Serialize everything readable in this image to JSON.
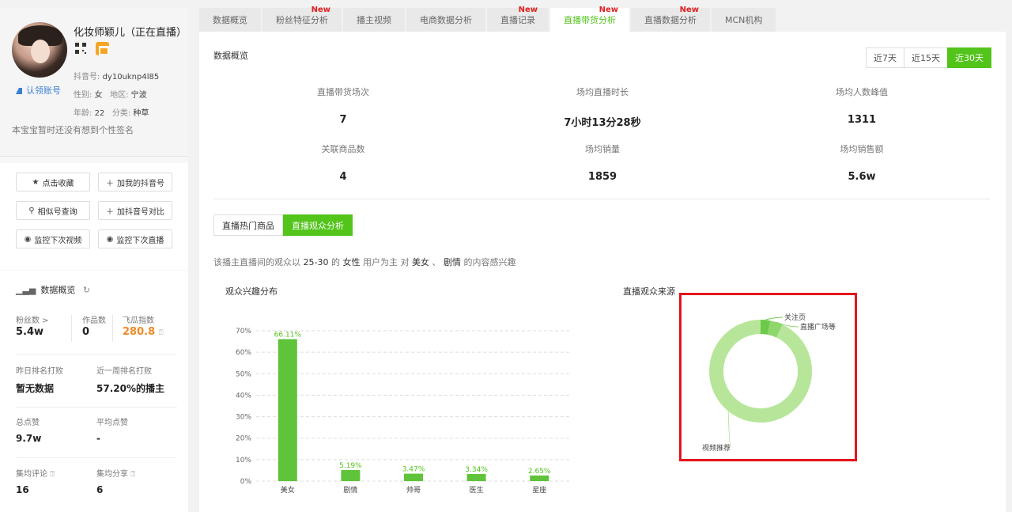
{
  "profile": {
    "name": "化妆师颖儿（正在直播）",
    "douyin_id_label": "抖音号:",
    "douyin_id": "dy10uknp4l85",
    "gender_label": "性别:",
    "gender": "女",
    "region_label": "地区:",
    "region": "宁波",
    "age_label": "年龄:",
    "age": "22",
    "category_label": "分类:",
    "category": "种草",
    "claim_label": "认领账号",
    "signature": "本宝宝暂时还没有想到个性签名"
  },
  "actions": {
    "favorite": "点击收藏",
    "add_account": "加我的抖音号",
    "similar_search": "相似号查询",
    "add_compare": "加抖音号对比",
    "monitor_video": "监控下次视频",
    "monitor_live": "监控下次直播"
  },
  "stats": {
    "title": "数据概览",
    "fans_label": "粉丝数 >",
    "fans": "5.4w",
    "works_label": "作品数",
    "works": "0",
    "feigua_label": "飞瓜指数",
    "feigua": "280.8",
    "yesterday_rank_label": "昨日排名打败",
    "yesterday_rank": "暂无数据",
    "week_rank_label": "近一周排名打败",
    "week_rank": "57.20%的播主",
    "total_likes_label": "总点赞",
    "total_likes": "9.7w",
    "avg_likes_label": "平均点赞",
    "avg_likes": "-",
    "avg_comments_label": "集均评论",
    "avg_comments": "16",
    "avg_shares_label": "集均分享",
    "avg_shares": "6"
  },
  "tabs": [
    {
      "label": "数据概览",
      "new": ""
    },
    {
      "label": "粉丝特征分析",
      "new": "New"
    },
    {
      "label": "播主视频",
      "new": ""
    },
    {
      "label": "电商数据分析",
      "new": ""
    },
    {
      "label": "直播记录",
      "new": "New"
    },
    {
      "label": "直播带货分析",
      "new": "New"
    },
    {
      "label": "直播数据分析",
      "new": "New"
    },
    {
      "label": "MCN机构",
      "new": ""
    }
  ],
  "overview": {
    "title": "数据概览",
    "ranges": [
      "近7天",
      "近15天",
      "近30天"
    ],
    "active_range": "近30天",
    "kpis": [
      {
        "label": "直播带货场次",
        "value": "7"
      },
      {
        "label": "场均直播时长",
        "value": "7小时13分28秒"
      },
      {
        "label": "场均人数峰值",
        "value": "1311"
      },
      {
        "label": "关联商品数",
        "value": "4"
      },
      {
        "label": "场均销量",
        "value": "1859"
      },
      {
        "label": "场均销售额",
        "value": "5.6w"
      }
    ]
  },
  "subtabs": [
    "直播热门商品",
    "直播观众分析"
  ],
  "summary": {
    "p1": "该播主直播间的观众以",
    "age": "25-30",
    "p2": "的",
    "gender": "女性",
    "p3": "用户为主 对",
    "interest1": "美女",
    "sep": "、",
    "interest2": "剧情",
    "p4": "的内容感兴趣"
  },
  "chart_titles": {
    "interest": "观众兴趣分布",
    "source": "直播观众来源"
  },
  "colors": {
    "accent": "#52c41a",
    "bar": "#5fc43a",
    "donut_main": "#b7e69a",
    "donut_small1": "#6cc94a",
    "donut_small2": "#8fd66c",
    "highlight_box": "#e3141b",
    "new_badge": "#e02020"
  },
  "chart_data": [
    {
      "type": "bar",
      "title": "观众兴趣分布",
      "categories": [
        "美女",
        "剧情",
        "帅哥",
        "医生",
        "星座"
      ],
      "values": [
        66.11,
        5.19,
        3.47,
        3.34,
        2.65
      ],
      "value_labels": [
        "66.11%",
        "5.19%",
        "3.47%",
        "3.34%",
        "2.65%"
      ],
      "ylim": [
        0,
        70
      ],
      "yticks": [
        "0%",
        "10%",
        "20%",
        "30%",
        "40%",
        "50%",
        "60%",
        "70%"
      ],
      "grid": true
    },
    {
      "type": "pie",
      "title": "直播观众来源",
      "labels": [
        "视频推荐",
        "关注页",
        "直播广场等"
      ],
      "values": [
        93,
        3,
        4
      ],
      "donut": true
    }
  ]
}
